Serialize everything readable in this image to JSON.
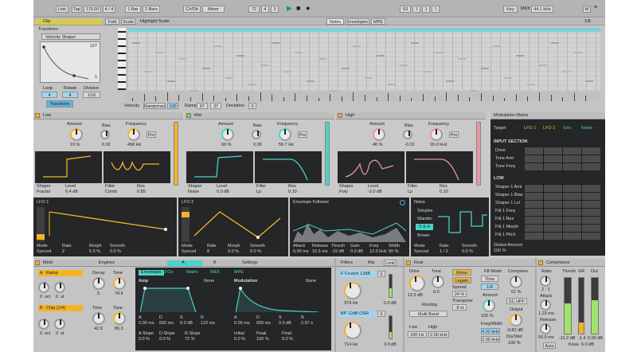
{
  "transport": {
    "link": "Link",
    "tap": "Tap",
    "tempo": "175.00",
    "sig": "4 / 4",
    "quant": "1 Bar",
    "loop_len": "2 Bars",
    "key": "C#/Db",
    "scale": "Minor",
    "pos1": "72",
    "pos2": "4",
    "pos3": "3",
    "cpu": "53",
    "bars": "1",
    "beats": "1",
    "end": "1",
    "key_label": "Key",
    "midi": "MIDI",
    "rate": "44.1 kHz",
    "mix": "W"
  },
  "clip": {
    "title": "Clip",
    "transform": "Transform",
    "fold": "Fold",
    "scale_btn": "Scale",
    "highlight": "Highlight Scale",
    "tabs": [
      "Notes",
      "Envelopes",
      "MPE"
    ],
    "page": "1/8",
    "device": "Velocity Shaper",
    "curve_max": "127",
    "curve_min": "1",
    "loop": "Loop",
    "rotate": "Rotate",
    "division": "Division",
    "loop_val": "4",
    "rotate_val": "4",
    "div_val": "1/16",
    "transform_btn": "Transform",
    "ruler": [
      "2",
      "3",
      "4",
      "5",
      "6",
      "7"
    ],
    "zoom": [
      "127",
      "64",
      "0"
    ],
    "velocity": "Velocity",
    "randomize": "Randomize",
    "rand_val": "100",
    "ramp": "Ramp",
    "ramp_a": "87",
    "ramp_b": "37",
    "deviation": "Deviation",
    "dev_val": "0"
  },
  "bands": [
    {
      "name": "Low",
      "amount_label": "Amount",
      "amount": "19 %",
      "bias_label": "Bias",
      "bias": "0.02",
      "freq_label": "Frequency",
      "freq": "458 Hz",
      "pre": "Pre",
      "shaper": "Shaper",
      "shaper_val": "Fractal",
      "level": "Level",
      "level_val": "6.4 dB",
      "filter": "Filter",
      "filter_val": "Comb",
      "res": "Res",
      "res_val": "0.85"
    },
    {
      "name": "Mid",
      "amount_label": "Amount",
      "amount": "69 %",
      "bias_label": "Bias",
      "bias": "0.00",
      "freq_label": "Frequency",
      "freq": "56.7 Hz",
      "pre": "Pre",
      "shaper": "Shaper",
      "shaper_val": "Noise",
      "level": "Level",
      "level_val": "0.0 dB",
      "filter": "Filter",
      "filter_val": "Lp",
      "res": "Res",
      "res_val": "0.10"
    },
    {
      "name": "High",
      "amount_label": "Amount",
      "amount": "46 %",
      "bias_label": "Bias",
      "bias": "-0.32",
      "freq_label": "Frequency",
      "freq": "20.0 kHz",
      "pre": "Pre",
      "shaper": "Shaper",
      "shaper_val": "Poly",
      "level": "Level",
      "level_val": "-2.0 dB",
      "filter": "Filter",
      "filter_val": "Lp",
      "res": "Res",
      "res_val": "0.10"
    }
  ],
  "mod_matrix": {
    "title": "Modulation Matrix",
    "target": "Target",
    "cols": [
      "LFO 1",
      "LFO 2",
      "Env",
      "Noise"
    ],
    "input_section": "INPUT SECTION",
    "inputs": [
      "Drive",
      "Tone Amt",
      "Tone Freq"
    ],
    "low_section": "LOW",
    "low_items": [
      "Shaper 1 Amt",
      "Shaper 1 Bias",
      "Shaper 1 Lvl",
      "Filt 1 Freq",
      "Filt 1 Res",
      "Filt 1 Morph",
      "Filt 1 Pitch"
    ],
    "global": "Global Amount",
    "global_val": "100 %"
  },
  "lfo1": {
    "title": "LFO 1",
    "mode": "Mode",
    "mode_val": "Synced",
    "rate": "Rate",
    "rate_val": "2",
    "morph": "Morph",
    "morph_val": "5.0 %",
    "smooth": "Smooth",
    "smooth_val": "0.0 %"
  },
  "lfo2": {
    "title": "LFO 2",
    "mode": "Mode",
    "mode_val": "Synced",
    "rate": "Rate",
    "rate_val": "8",
    "morph": "Morph",
    "morph_val": "0.0 %",
    "smooth": "Smooth",
    "smooth_val": "0.0 %"
  },
  "envfollow": {
    "title": "Envelope Follower",
    "attack": "Attack",
    "attack_val": "0.00 ms",
    "release": "Release",
    "release_val": "16.5 ms",
    "thresh": "Thresh",
    "thresh_val": "-19 dB",
    "gain": "Gain",
    "gain_val": "0.0 dB",
    "freq": "Freq",
    "freq_val": "12.0 kHz",
    "width": "Width",
    "width_val": "50 %"
  },
  "noise": {
    "title": "Noise",
    "types": [
      "Simplex",
      "Wander",
      "S & H",
      "Brown"
    ],
    "mode": "Mode",
    "mode_val": "Synced",
    "rate": "Rate",
    "rate_val": "1 / 2",
    "smooth": "Smooth",
    "smooth_val": "0.0 %"
  },
  "meld": {
    "title": "Meld",
    "engines": "Engines",
    "a": "A",
    "b": "B",
    "settings": "Settings",
    "osc_a": "Ramp",
    "osc_b": "Chip (1/4)",
    "decay": "Decay",
    "decay_val": "5",
    "tone": "Tone",
    "tone_val": "74.6",
    "tone2": "Tone",
    "tone2_val": "42.9",
    "tone3": "Tone",
    "tone3_val": "86.3",
    "oct": [
      "0",
      "0",
      "0",
      "0"
    ],
    "oct_lbl": [
      "oct",
      "st",
      "oct",
      "st"
    ],
    "subtabs": [
      "Envelopes",
      "LFOs",
      "Matrix",
      "MIDI",
      "MPE"
    ],
    "amp": "Amp",
    "amp_target": "None",
    "modulation": "Modulation",
    "mod_target": "None",
    "adsr_labels": [
      "A",
      "D",
      "S",
      "R"
    ],
    "adsr_vals": [
      "0.00 ms",
      "600 ms",
      "0.0 dB",
      "122 ms"
    ],
    "mod_labels": [
      "A",
      "D",
      "S",
      "R"
    ],
    "mod_vals": [
      "0.00 ms",
      "600 ms",
      "0.0 dB",
      "2.97 s"
    ],
    "slopes": [
      "A Slope",
      "D Slope",
      "R Slope",
      "Initial",
      "Peak",
      "Final"
    ],
    "slope_vals": [
      "0.0 %",
      "0.0 %",
      "72 %",
      "0.0 %",
      "100 %",
      "0.0 %"
    ]
  },
  "filters": {
    "title": "Filters",
    "mix": "Mix",
    "limit": "Limit",
    "f1": "F Crunch 12dB",
    "f1_knob": "374 Hz",
    "f2": "BP 12dB OSR",
    "f2_knob": "714 Hz",
    "s_label": "S",
    "a_val": "0.0 dB",
    "b_val": "0.0 dB"
  },
  "roar": {
    "title": "Roar",
    "drive": "Drive",
    "drive_val": "12.5 dB",
    "tone": "Tone",
    "tone_val": "0.0",
    "mode": "Mono",
    "legato": "Legato",
    "spread_lbl": "Spread",
    "spread": "24 %",
    "tr_lbl": "Transpose",
    "transpose": "-8 st",
    "routing": "Routing",
    "routing_val": "Multi Band",
    "fb_mode": "FB Mode",
    "fb_time": "Time",
    "fb_val": "1/4",
    "compress": "Compress",
    "comp_val": "61 %",
    "freq_lbl": "Freq/Width",
    "freq_val": "4.32 kHz",
    "width_val": "2.00 kHz",
    "low": "Low",
    "high": "High",
    "low_val": "200 Hz",
    "high_val": "2.00 kHz",
    "output": "Output",
    "out_val": "-0.82 dB",
    "drywet": "Dry/Wet",
    "dw_val": "100 %",
    "sc": "SC HPF",
    "amount": "Amount",
    "amount_val": "100 %"
  },
  "compressor": {
    "title": "Compressor",
    "ratio": "Ratio",
    "ratio_val": "2 : 1",
    "attack": "Attack",
    "attack_val": "1.23 ms",
    "release": "Release",
    "release_val": "50.0 ms",
    "auto": "Auto",
    "thresh": "Thresh",
    "thresh_val": "-11.2 dB",
    "gr": "GR",
    "gr_val": "-1.4",
    "out": "Out",
    "out_val": "0.00 dB",
    "knee": "Knee",
    "knee_val": "6.0 dB",
    "mode": "Peak",
    "expand": "Expand",
    "makeup": "Makeup",
    "lookahead": "Lookahead",
    "dry": "Dry/Wet"
  },
  "colors": {
    "accent": "#f2b425",
    "teal": "#4ad3c8",
    "pink": "#e895a4",
    "dark": "#242627",
    "panel": "#c9c9c9"
  }
}
